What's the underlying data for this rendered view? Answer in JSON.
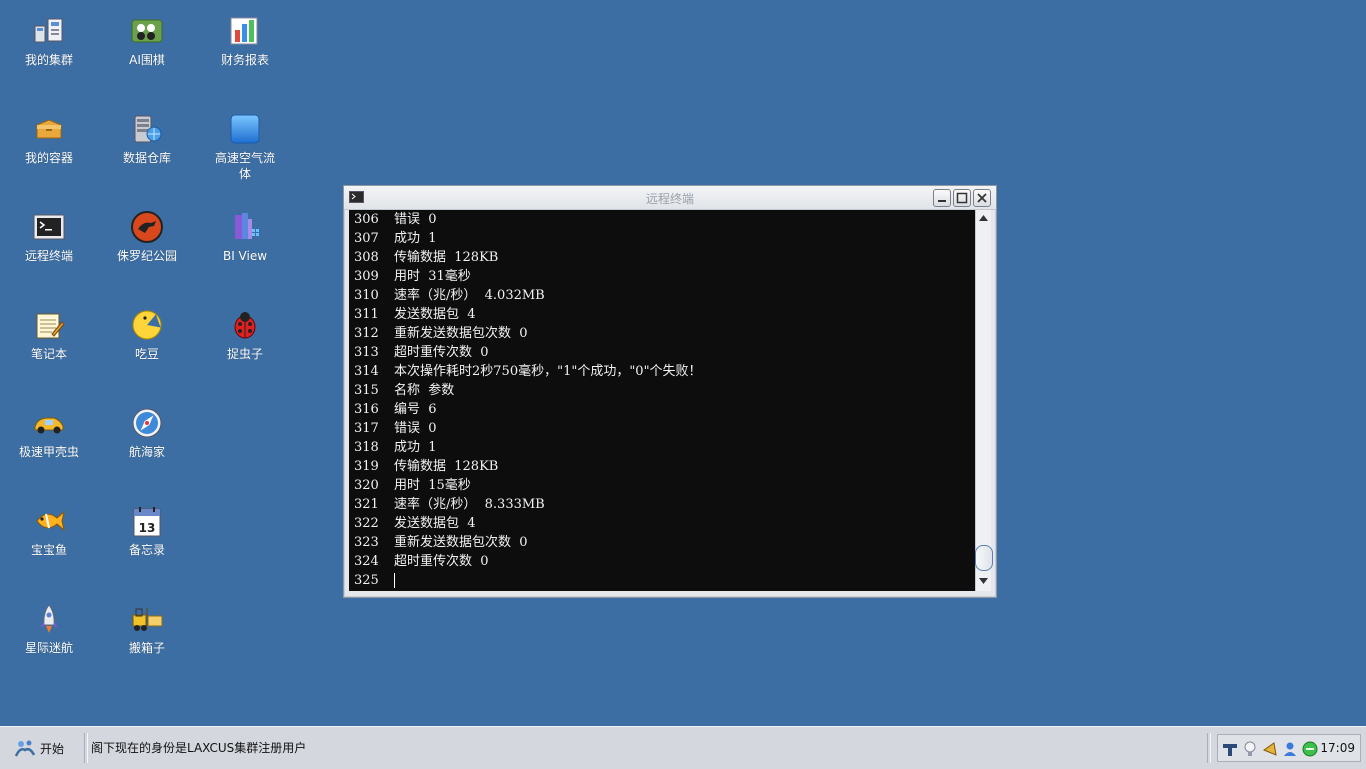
{
  "desktop": {
    "icons": [
      {
        "label": "我的集群"
      },
      {
        "label": "AI围棋"
      },
      {
        "label": "财务报表"
      },
      {
        "label": "我的容器"
      },
      {
        "label": "数据仓库"
      },
      {
        "label": "高速空气流体"
      },
      {
        "label": "远程终端"
      },
      {
        "label": "侏罗纪公园"
      },
      {
        "label": "BI View"
      },
      {
        "label": "笔记本"
      },
      {
        "label": "吃豆"
      },
      {
        "label": "捉虫子"
      },
      {
        "label": "极速甲壳虫"
      },
      {
        "label": "航海家"
      },
      {
        "label": "宝宝鱼"
      },
      {
        "label": "备忘录"
      },
      {
        "label": "星际迷航"
      },
      {
        "label": "搬箱子"
      }
    ]
  },
  "terminal": {
    "title": "远程终端",
    "lines": [
      {
        "n": "306",
        "t": "错误  0"
      },
      {
        "n": "307",
        "t": "成功  1"
      },
      {
        "n": "308",
        "t": "传输数据  128KB"
      },
      {
        "n": "309",
        "t": "用时  31毫秒"
      },
      {
        "n": "310",
        "t": "速率（兆/秒）  4.032MB"
      },
      {
        "n": "311",
        "t": "发送数据包  4"
      },
      {
        "n": "312",
        "t": "重新发送数据包次数  0"
      },
      {
        "n": "313",
        "t": "超时重传次数  0"
      },
      {
        "n": "314",
        "t": "本次操作耗时2秒750毫秒，\"1\"个成功，\"0\"个失败！"
      },
      {
        "n": "315",
        "t": "名称  参数"
      },
      {
        "n": "316",
        "t": "编号  6"
      },
      {
        "n": "317",
        "t": "错误  0"
      },
      {
        "n": "318",
        "t": "成功  1"
      },
      {
        "n": "319",
        "t": "传输数据  128KB"
      },
      {
        "n": "320",
        "t": "用时  15毫秒"
      },
      {
        "n": "321",
        "t": "速率（兆/秒）  8.333MB"
      },
      {
        "n": "322",
        "t": "发送数据包  4"
      },
      {
        "n": "323",
        "t": "重新发送数据包次数  0"
      },
      {
        "n": "324",
        "t": "超时重传次数  0"
      },
      {
        "n": "325",
        "t": ""
      }
    ]
  },
  "taskbar": {
    "start_label": "开始",
    "status_text": "阁下现在的身份是LAXCUS集群注册用户",
    "clock": "17:09"
  }
}
